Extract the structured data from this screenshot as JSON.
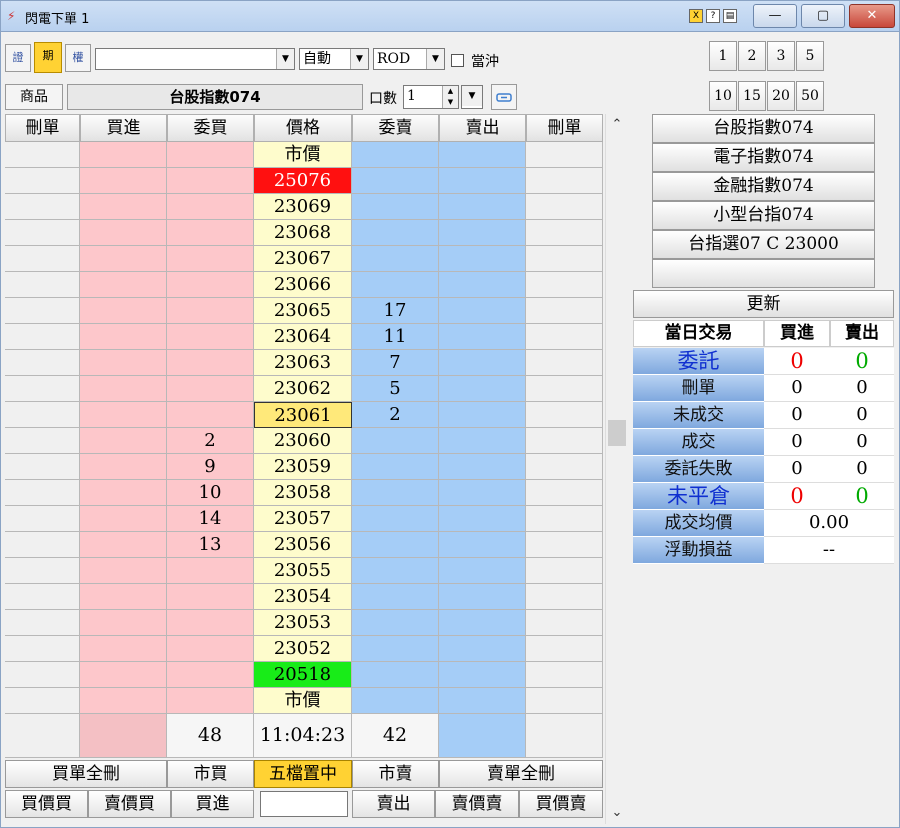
{
  "window": {
    "title": "閃電下單 1",
    "icon_glyph": "⚡",
    "mini_buttons": [
      "X",
      "?",
      "▤"
    ],
    "btn_min": "—",
    "btn_max": "▢",
    "btn_close": "✕"
  },
  "toolbar": {
    "mode_buttons": [
      "證",
      "期",
      "權"
    ],
    "active_mode": "期",
    "product_combo_value": "",
    "condition_value": "自動",
    "order_type_value": "ROD",
    "daytrade_label": "當沖",
    "qty_label": "口數",
    "qty_value": "1",
    "arrow_glyph": "▼",
    "spin_up": "▲",
    "spin_down": "▼"
  },
  "quick_qty": {
    "row1": [
      "1",
      "2",
      "3",
      "5"
    ],
    "row2": [
      "10",
      "15",
      "20",
      "50"
    ]
  },
  "product": {
    "button_label": "商品",
    "name": "台股指數074"
  },
  "grid": {
    "headers": [
      "刪單",
      "買進",
      "委買",
      "價格",
      "委賣",
      "賣出",
      "刪單"
    ],
    "rows": [
      {
        "price": "市價",
        "bid": "",
        "ask": "",
        "style": "normal"
      },
      {
        "price": "25076",
        "bid": "",
        "ask": "",
        "style": "red"
      },
      {
        "price": "23069",
        "bid": "",
        "ask": "",
        "style": "normal"
      },
      {
        "price": "23068",
        "bid": "",
        "ask": "",
        "style": "normal"
      },
      {
        "price": "23067",
        "bid": "",
        "ask": "",
        "style": "normal"
      },
      {
        "price": "23066",
        "bid": "",
        "ask": "",
        "style": "normal"
      },
      {
        "price": "23065",
        "bid": "",
        "ask": "17",
        "style": "normal"
      },
      {
        "price": "23064",
        "bid": "",
        "ask": "11",
        "style": "normal"
      },
      {
        "price": "23063",
        "bid": "",
        "ask": "7",
        "style": "normal"
      },
      {
        "price": "23062",
        "bid": "",
        "ask": "5",
        "style": "normal"
      },
      {
        "price": "23061",
        "bid": "",
        "ask": "2",
        "style": "last"
      },
      {
        "price": "23060",
        "bid": "2",
        "ask": "",
        "style": "normal"
      },
      {
        "price": "23059",
        "bid": "9",
        "ask": "",
        "style": "normal"
      },
      {
        "price": "23058",
        "bid": "10",
        "ask": "",
        "style": "normal"
      },
      {
        "price": "23057",
        "bid": "14",
        "ask": "",
        "style": "normal"
      },
      {
        "price": "23056",
        "bid": "13",
        "ask": "",
        "style": "normal"
      },
      {
        "price": "23055",
        "bid": "",
        "ask": "",
        "style": "normal"
      },
      {
        "price": "23054",
        "bid": "",
        "ask": "",
        "style": "normal"
      },
      {
        "price": "23053",
        "bid": "",
        "ask": "",
        "style": "normal"
      },
      {
        "price": "23052",
        "bid": "",
        "ask": "",
        "style": "normal"
      },
      {
        "price": "20518",
        "bid": "",
        "ask": "",
        "style": "green"
      },
      {
        "price": "市價",
        "bid": "",
        "ask": "",
        "style": "normal"
      }
    ],
    "footer": {
      "bid_total": "48",
      "time": "11:04:23",
      "ask_total": "42"
    }
  },
  "actions": {
    "row1": [
      "買單全刪",
      "市買",
      "五檔置中",
      "市賣",
      "賣單全刪"
    ],
    "row2": [
      "買價買",
      "賣價買",
      "買進",
      "",
      "賣出",
      "賣價賣",
      "買價賣"
    ]
  },
  "scrollbar": {
    "up": "⌃",
    "down": "⌄"
  },
  "product_list": [
    "台股指數074",
    "電子指數074",
    "金融指數074",
    "小型台指074",
    "台指選07 C 23000",
    ""
  ],
  "stats": {
    "refresh_label": "更新",
    "header": [
      "當日交易",
      "買進",
      "賣出"
    ],
    "rows": [
      {
        "label": "委託",
        "buy": "0",
        "sell": "0",
        "big": true
      },
      {
        "label": "刪單",
        "buy": "0",
        "sell": "0",
        "big": false
      },
      {
        "label": "未成交",
        "buy": "0",
        "sell": "0",
        "big": false
      },
      {
        "label": "成交",
        "buy": "0",
        "sell": "0",
        "big": false
      },
      {
        "label": "委託失敗",
        "buy": "0",
        "sell": "0",
        "big": false
      },
      {
        "label": "未平倉",
        "buy": "0",
        "sell": "0",
        "big": true
      }
    ],
    "avg_price_label": "成交均價",
    "avg_price_value": "0.00",
    "pnl_label": "浮動損益",
    "pnl_value": "--"
  }
}
